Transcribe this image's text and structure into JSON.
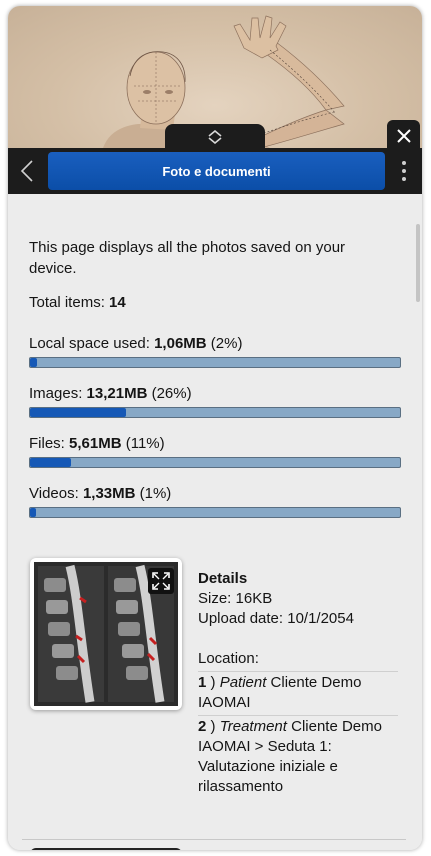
{
  "header": {
    "title": "Foto e documenti"
  },
  "intro_text": "This page displays all the photos saved on your device.",
  "stats": {
    "total_label": "Total items: ",
    "total_value": "14",
    "local": {
      "label": "Local space used: ",
      "value": "1,06MB",
      "pct_text": " (2%)",
      "fraction": 0.02
    },
    "images": {
      "label": "Images: ",
      "value": "13,21MB",
      "pct_text": " (26%)",
      "fraction": 0.26
    },
    "files": {
      "label": "Files: ",
      "value": "5,61MB",
      "pct_text": " (11%)",
      "fraction": 0.11
    },
    "videos": {
      "label": "Videos: ",
      "value": "1,33MB",
      "pct_text": " (1%)",
      "fraction": 0.01
    }
  },
  "item": {
    "details_title": "Details",
    "size": "Size: 16KB",
    "upload_date": "Upload date: 10/1/2054",
    "location_label": "Location:",
    "locations": [
      {
        "num": "1",
        "sep": " ) ",
        "type": "Patient",
        "text": " Cliente Demo IAOMAI"
      },
      {
        "num": "2",
        "sep": " ) ",
        "type": "Treatment",
        "text": " Cliente Demo IAOMAI > Seduta 1: Valutazione iniziale e rilassamento"
      }
    ]
  },
  "colors": {
    "accent": "#0b4ea8",
    "bar_fill": "#1558b6",
    "bar_track": "#87a8c6",
    "topbar": "#1c1c1c"
  },
  "icons": {
    "back": "chevron-left-icon",
    "handle": "chevron-up-down-icon",
    "close": "close-icon",
    "menu": "more-vertical-icon",
    "expand": "expand-icon"
  }
}
